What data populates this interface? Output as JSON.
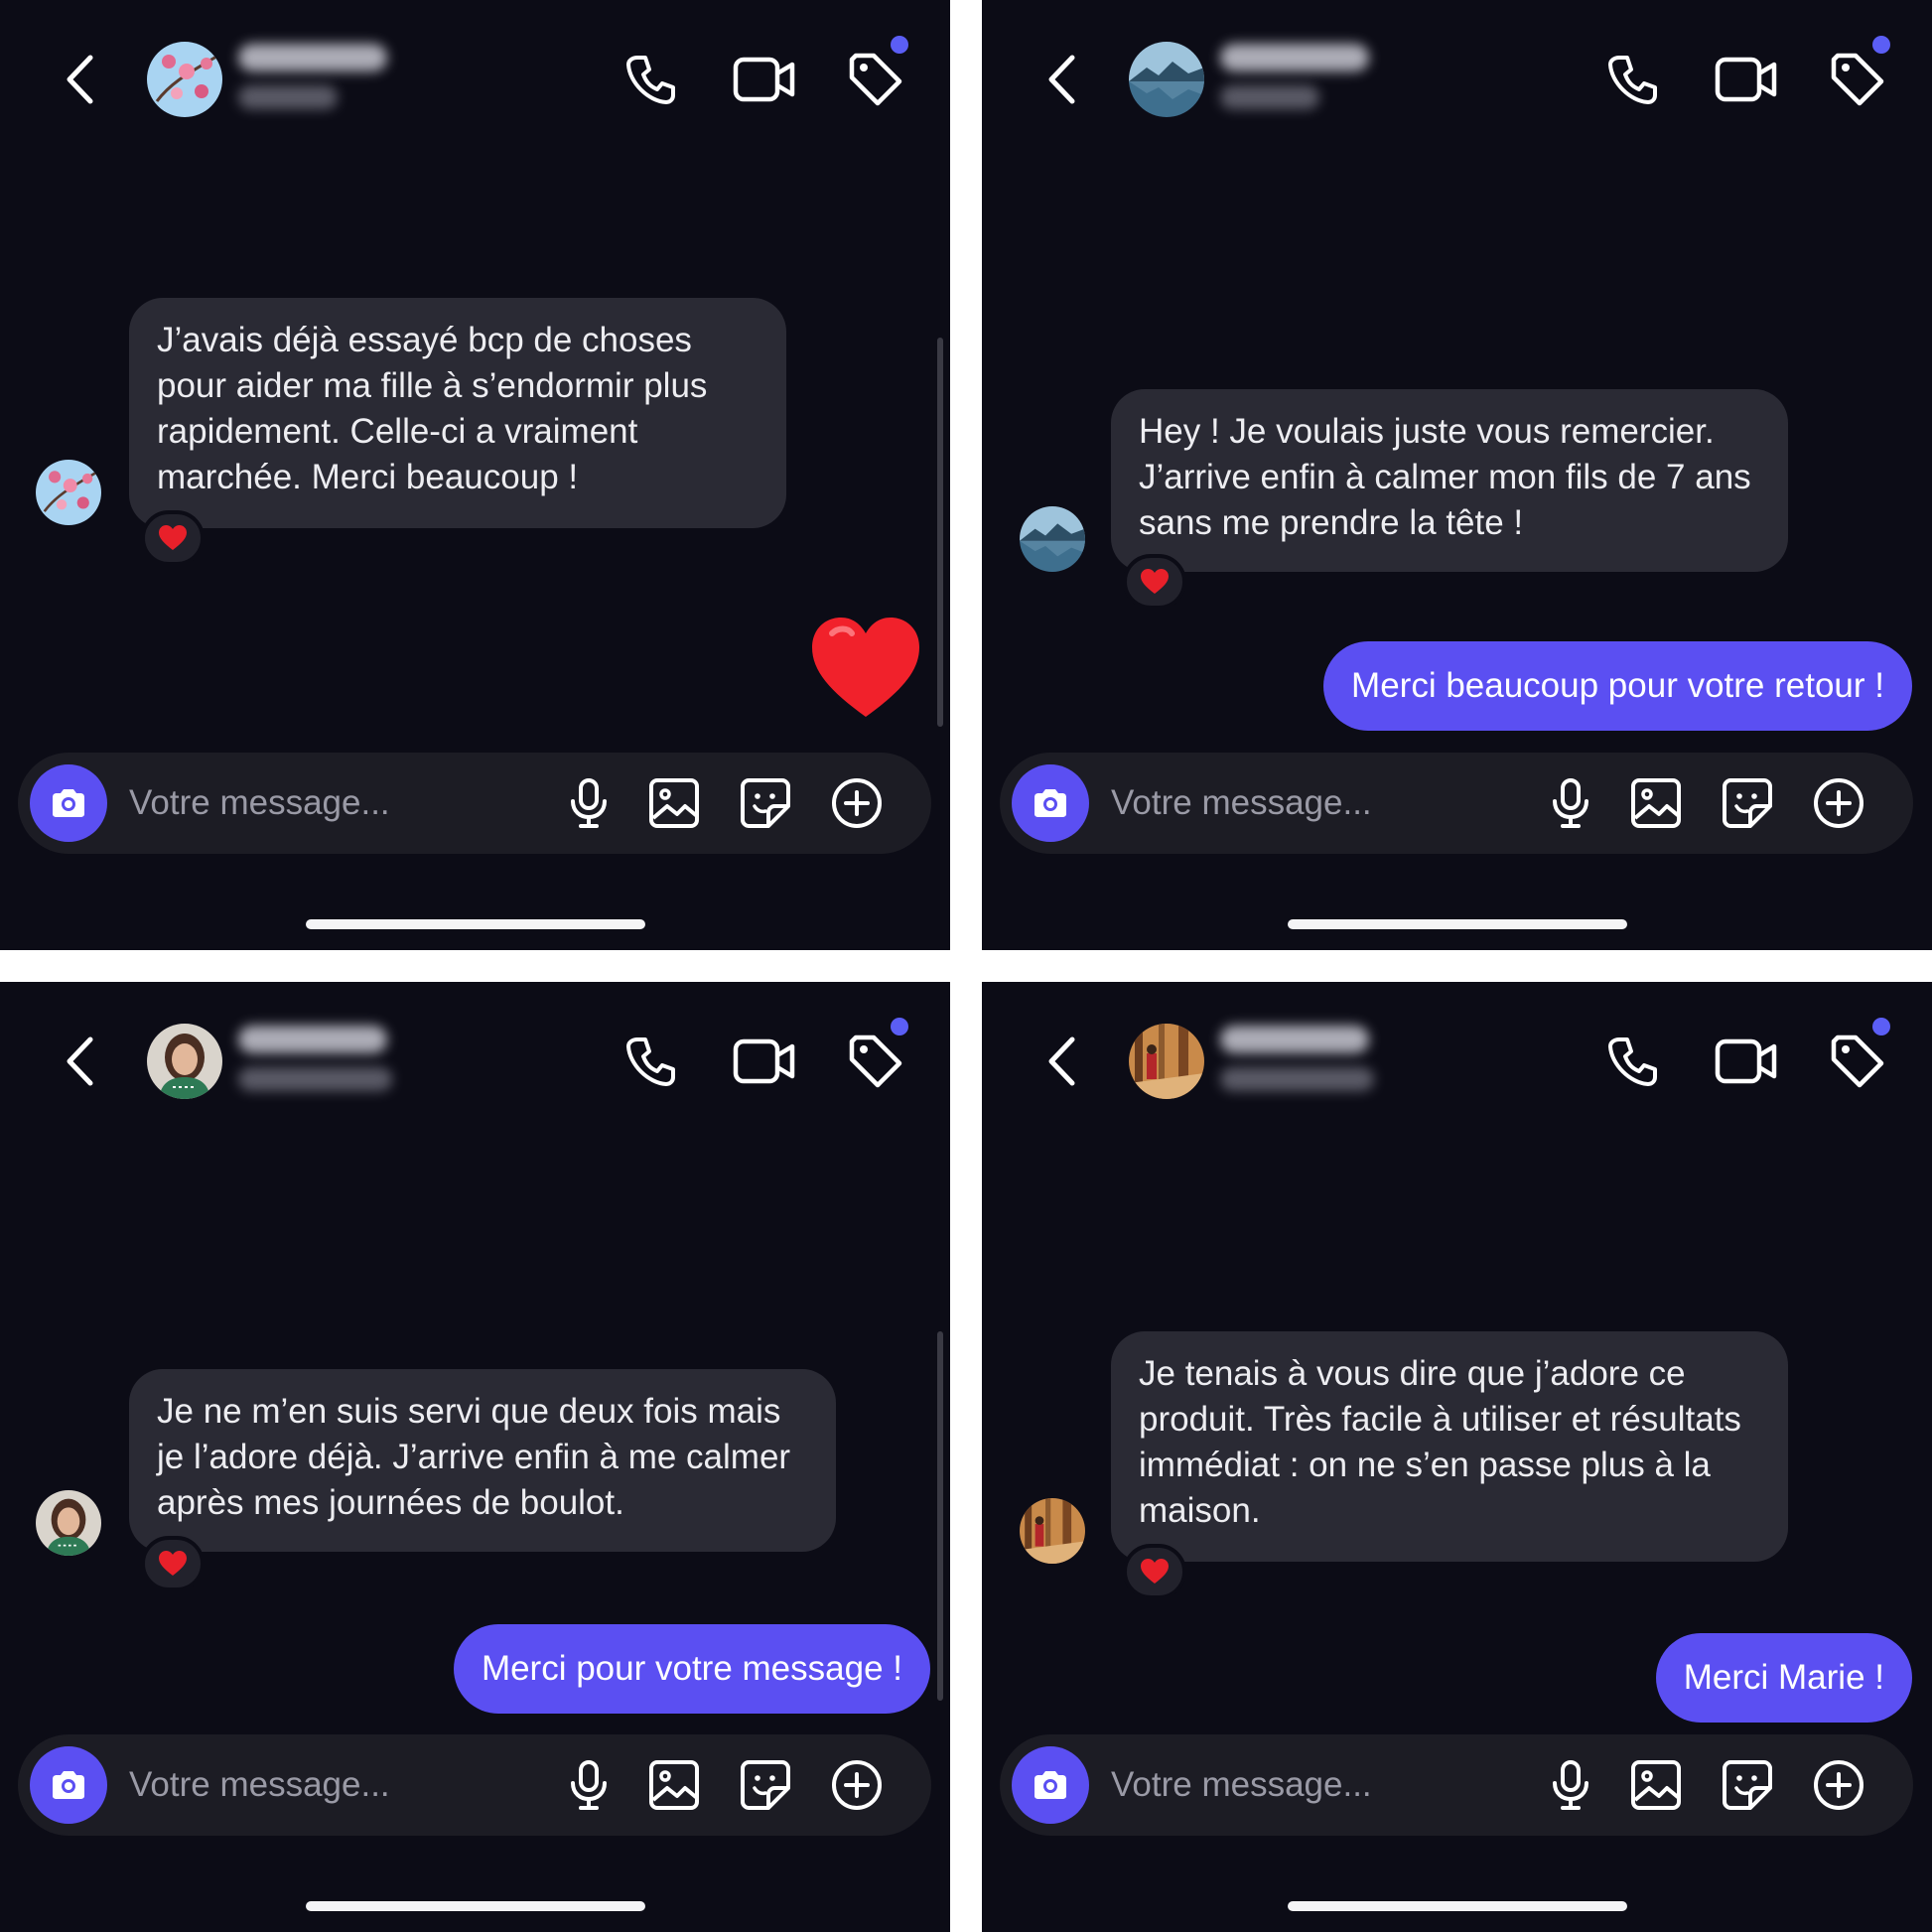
{
  "composer": {
    "placeholder": "Votre message..."
  },
  "conversations": [
    {
      "incoming": {
        "text": "J’avais déjà essayé bcp de choses pour aider ma fille à s’endormir plus rapidement. Celle-ci a vraiment marchée. Merci beaucoup !",
        "reaction": "heart"
      },
      "outgoing": null,
      "sent_emoji": "heart"
    },
    {
      "incoming": {
        "text": "Hey ! Je voulais juste vous remercier. J’arrive enfin à calmer mon fils de 7 ans sans me prendre la tête !",
        "reaction": "heart"
      },
      "outgoing": {
        "text": "Merci beaucoup pour votre retour !"
      }
    },
    {
      "incoming": {
        "text": "Je ne m’en suis servi que deux fois mais je l’adore déjà. J’arrive enfin à me calmer après mes journées de boulot.",
        "reaction": "heart"
      },
      "outgoing": {
        "text": "Merci pour votre message !"
      }
    },
    {
      "incoming": {
        "text": "Je tenais à vous dire que j’adore ce produit. Très facile à utiliser et résultats immédiat : on ne s’en passe plus à la maison.",
        "reaction": "heart"
      },
      "outgoing": {
        "text": "Merci Marie !"
      }
    }
  ],
  "colors": {
    "background": "#0c0c16",
    "bubble_in": "#2a2a34",
    "bubble_out": "#5b4ff2",
    "accent": "#5b5ef5"
  }
}
